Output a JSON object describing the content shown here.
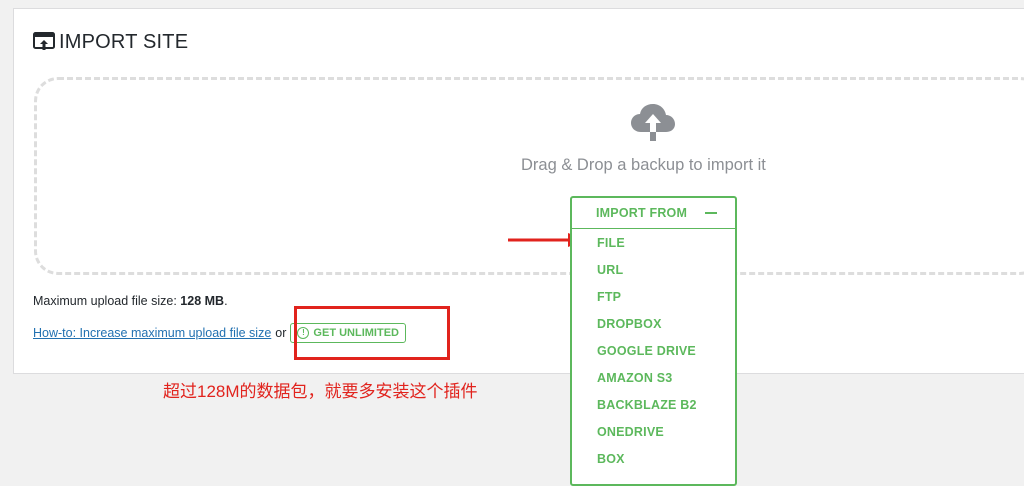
{
  "header": {
    "title": "IMPORT SITE",
    "icon": "import-site-icon"
  },
  "dropzone": {
    "icon": "cloud-upload-icon",
    "text": "Drag & Drop a backup to import it"
  },
  "import_menu": {
    "label": "IMPORT FROM",
    "items": [
      "FILE",
      "URL",
      "FTP",
      "DROPBOX",
      "GOOGLE DRIVE",
      "AMAZON S3",
      "BACKBLAZE B2",
      "ONEDRIVE",
      "BOX"
    ]
  },
  "upload_info": {
    "label": "Maximum upload file size:",
    "value": "128 MB",
    "suffix": "."
  },
  "howto": {
    "link": "How-to: Increase maximum upload file size",
    "or": "or",
    "unlimited_button": "GET UNLIMITED"
  },
  "annotation": {
    "text": "超过128M的数据包，就要多安装这个插件"
  },
  "colors": {
    "accent": "#5cb85c",
    "link": "#2271b1",
    "annotation": "#e1231d",
    "muted": "#8c8f94"
  }
}
